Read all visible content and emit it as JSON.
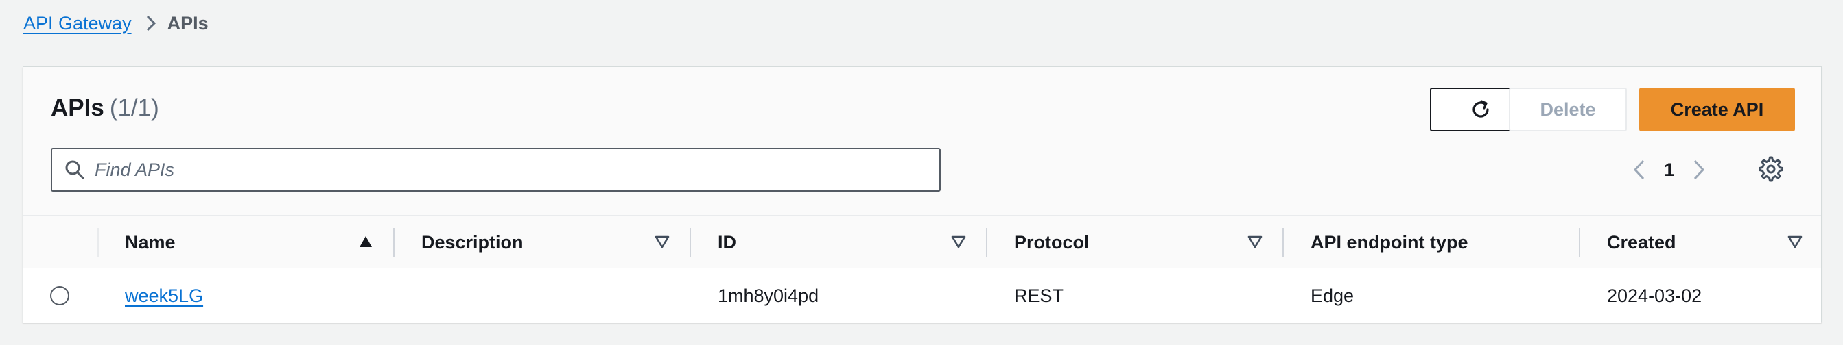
{
  "breadcrumb": {
    "items": [
      {
        "label": "API Gateway"
      },
      {
        "label": "APIs"
      }
    ]
  },
  "panel": {
    "title": "APIs",
    "count": "(1/1)"
  },
  "actions": {
    "refresh_icon": "refresh-icon",
    "delete_label": "Delete",
    "create_label": "Create API"
  },
  "search": {
    "placeholder": "Find APIs",
    "value": ""
  },
  "pagination": {
    "current_page": "1"
  },
  "table": {
    "columns": [
      {
        "label": "Name",
        "sort": "ascending"
      },
      {
        "label": "Description",
        "sort": "none"
      },
      {
        "label": "ID",
        "sort": "none"
      },
      {
        "label": "Protocol",
        "sort": "none"
      },
      {
        "label": "API endpoint type",
        "sort": "none"
      },
      {
        "label": "Created",
        "sort": "none"
      }
    ],
    "rows": [
      {
        "selected": false,
        "name": "week5LG",
        "description": "",
        "id": "1mh8y0i4pd",
        "protocol": "REST",
        "endpoint_type": "Edge",
        "created": "2024-03-02"
      }
    ]
  },
  "colors": {
    "link": "#0972d3",
    "primary_button": "#ec912d",
    "background": "#f2f3f3"
  }
}
